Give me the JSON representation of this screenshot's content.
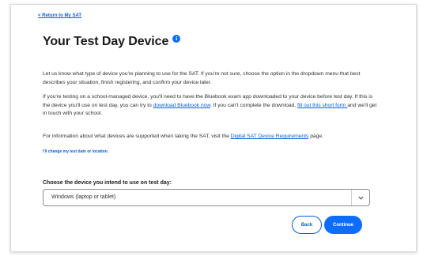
{
  "nav": {
    "back_label": "< Return to My SAT"
  },
  "header": {
    "title": "Your Test Day Device",
    "info_icon_glyph": "i"
  },
  "content": {
    "p1": "Let us know what type of device you're planning to use for the SAT. If you're not sure, choose the option in the dropdown menu that best describes your situation, finish registering, and confirm your device later.",
    "p2_a": "If you're testing on a school-managed device, you'll need to have the Bluebook exam app downloaded to your device before test day. If this is the device you'll use on test day, you can try to ",
    "p2_link1": "download Bluebook now",
    "p2_b": ". If you can't complete the download, ",
    "p2_link2": "fill out this short form ",
    "p2_c": "and we'll get in touch with your school.",
    "p3_a": "For information about what devices are supported when taking the SAT, visit the ",
    "p3_link": "Digital SAT Device Requirements",
    "p3_b": " page.",
    "change_link": "I'll change my test date or location."
  },
  "device_select": {
    "label": "Choose the device you intend to use on test day:",
    "value": "Windows (laptop or tablet)",
    "chevron_icon": "chevron-down-icon"
  },
  "actions": {
    "back_label": "Back",
    "continue_label": "Continue"
  },
  "colors": {
    "accent": "#0d6efd",
    "link": "#0b5ed7",
    "text": "#333333"
  }
}
